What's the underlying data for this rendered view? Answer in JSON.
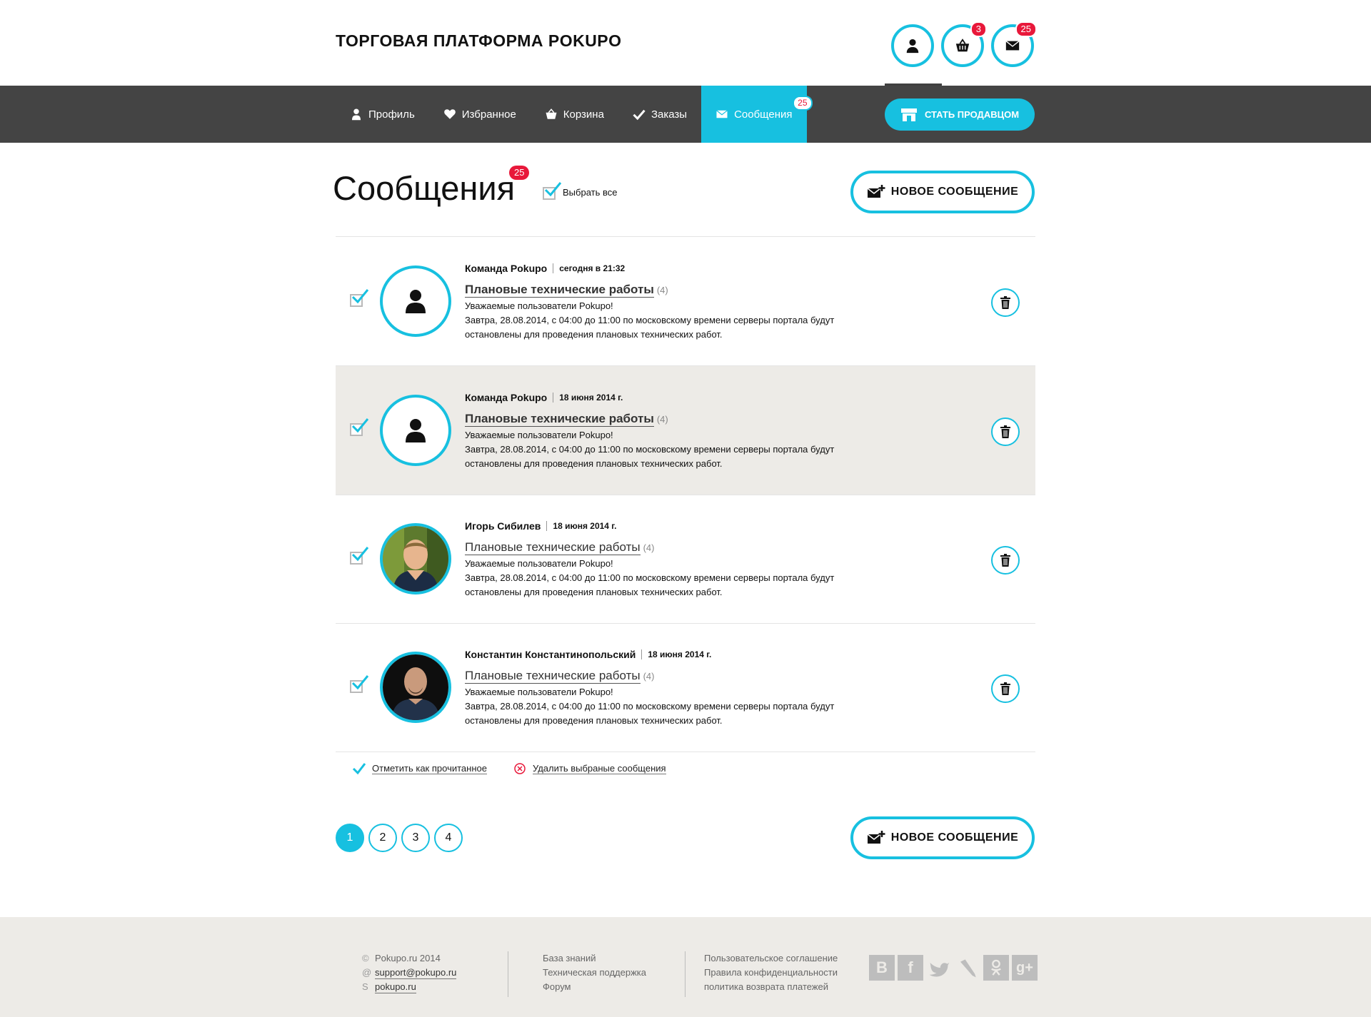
{
  "header": {
    "title": "ТОРГОВАЯ ПЛАТФОРМА POKUPO",
    "icons": [
      {
        "name": "user-icon",
        "badge": ""
      },
      {
        "name": "basket-icon",
        "badge": "3"
      },
      {
        "name": "mail-icon",
        "badge": "25"
      }
    ]
  },
  "nav": {
    "items": [
      {
        "label": "Профиль",
        "icon": "user-icon"
      },
      {
        "label": "Избранное",
        "icon": "heart-icon"
      },
      {
        "label": "Корзина",
        "icon": "basket-icon"
      },
      {
        "label": "Заказы",
        "icon": "check-icon"
      },
      {
        "label": "Сообщения",
        "icon": "mail-icon",
        "badge": "25",
        "active": true
      }
    ],
    "seller_button": "СТАТЬ ПРОДАВЦОМ"
  },
  "page": {
    "title": "Сообщения",
    "badge": "25",
    "select_all": "Выбрать все",
    "new_message": "НОВОЕ СООБЩЕНИЕ"
  },
  "messages": [
    {
      "author": "Команда Pokupo",
      "date": "сегодня в 21:32",
      "subject": "Плановые технические работы",
      "count": "(4)",
      "line1": "Уважаемые пользователи Pokupo!",
      "line2": "Завтра, 28.08.2014, с 04:00 до 11:00 по московскому времени серверы портала будут",
      "line3": "остановлены для проведения плановых технических работ.",
      "unread": true,
      "avatar": "person-icon"
    },
    {
      "author": "Команда Pokupo",
      "date": "18 июня 2014 г.",
      "subject": "Плановые технические работы",
      "count": "(4)",
      "line1": "Уважаемые пользователи Pokupo!",
      "line2": "Завтра, 28.08.2014, с 04:00 до 11:00 по московскому времени серверы портала будут",
      "line3": "остановлены для проведения плановых технических работ.",
      "unread": true,
      "avatar": "person-icon"
    },
    {
      "author": "Игорь Сибилев",
      "date": "18 июня 2014 г.",
      "subject": "Плановые технические работы",
      "count": "(4)",
      "line1": "Уважаемые пользователи Pokupo!",
      "line2": "Завтра, 28.08.2014, с 04:00 до 11:00 по московскому времени серверы портала будут",
      "line3": "остановлены для проведения плановых технических работ.",
      "unread": false,
      "avatar": "photo"
    },
    {
      "author": "Константин Константинопольский",
      "date": "18 июня 2014 г.",
      "subject": "Плановые технические работы",
      "count": "(4)",
      "line1": "Уважаемые пользователи Pokupo!",
      "line2": "Завтра, 28.08.2014, с 04:00 до 11:00 по московскому времени серверы портала будут",
      "line3": "остановлены для проведения плановых технических работ.",
      "unread": false,
      "avatar": "photo"
    }
  ],
  "actions": {
    "mark_read": "Отметить как прочитанное",
    "delete_selected": "Удалить выбраные сообщения"
  },
  "pagination": [
    "1",
    "2",
    "3",
    "4"
  ],
  "footer": {
    "copyright": "Pokupo.ru 2014",
    "email": "support@pokupo.ru",
    "skype": "pokupo.ru",
    "col2": [
      "База знаний",
      "Техническая поддержка",
      "Форум"
    ],
    "col3": [
      "Пользовательское соглашение",
      "Правила конфиденциальности",
      "политика возврата платежей"
    ]
  },
  "colors": {
    "accent": "#17c0e0",
    "badge": "#e8183a",
    "navbar": "#444444",
    "footer": "#edebe7"
  }
}
